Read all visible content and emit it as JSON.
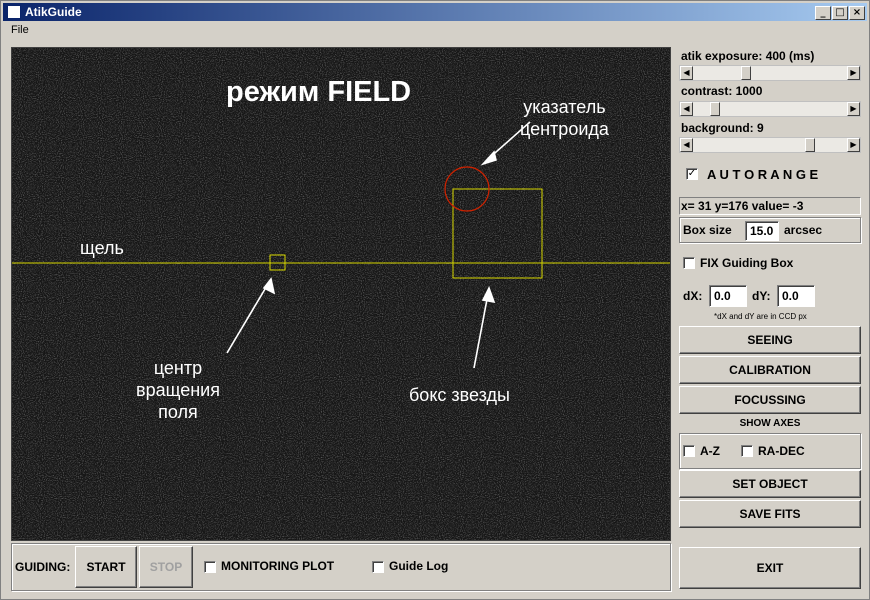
{
  "window": {
    "title": "AtikGuide",
    "controls": [
      "_",
      "□",
      "×"
    ]
  },
  "menu": {
    "file": "File"
  },
  "viewport": {
    "mode_title": "режим FIELD",
    "label_centroid": "указатель\nцентроида",
    "label_slit": "щель",
    "label_rotation": "центр\nвращения\nполя",
    "label_starbox": "бокс звезды"
  },
  "controls": {
    "exposure_label": "atik exposure:   400 (ms)",
    "exposure_level": 0.33,
    "contrast_label": "contrast:  1000",
    "contrast_level": 0.12,
    "background_label": "background:     9",
    "background_level": 0.78,
    "autorange_label": "A U T O R A N G E",
    "autorange_checked": "✓",
    "coords_text": "x= 31 y=176 value=    -3",
    "box_size_label": "Box size",
    "box_size_value": "15.0",
    "box_size_unit": "arcsec",
    "fix_box_label": "FIX Guiding Box",
    "dx_label": "dX:",
    "dx_value": "0.0",
    "dy_label": "dY:",
    "dy_value": "0.0",
    "ccd_note": "*dX and dY are in CCD px",
    "seeing": "SEEING",
    "calibration": "CALIBRATION",
    "focussing": "FOCUSSING",
    "show_axes": "SHOW AXES",
    "az_label": "A-Z",
    "radec_label": "RA-DEC",
    "set_object": "SET OBJECT",
    "save_fits": "SAVE FITS",
    "exit": "EXIT"
  },
  "guiding": {
    "label": "GUIDING:",
    "start": "START",
    "stop": "STOP",
    "monitoring": "MONITORING PLOT",
    "guide_log": "Guide Log"
  },
  "colors": {
    "slit": "#d8d800",
    "centroid": "#cc2200",
    "starbox": "#d8d800",
    "titlebar": "#0a246a"
  }
}
